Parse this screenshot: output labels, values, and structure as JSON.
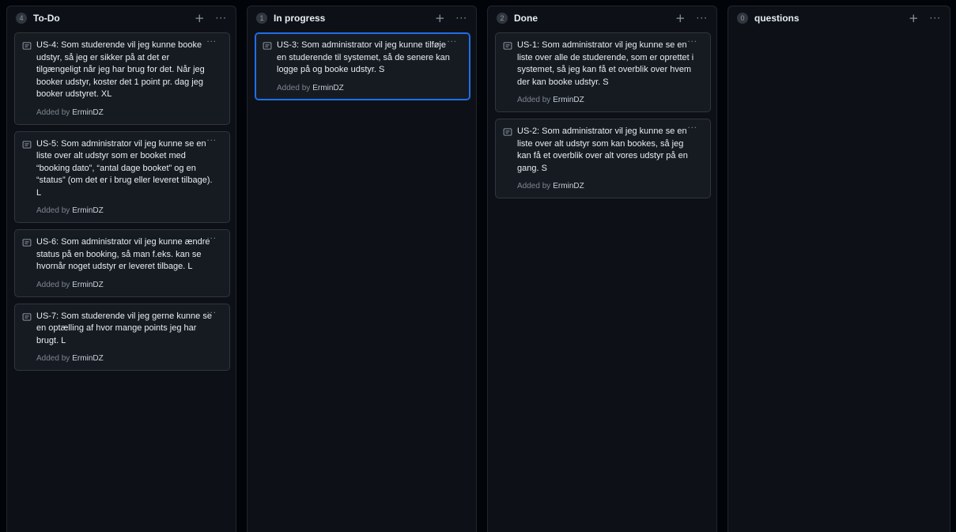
{
  "columns": [
    {
      "count": "4",
      "title": "To-Do",
      "cards": [
        {
          "title": "US-4: Som studerende vil jeg kunne booke udstyr, så jeg er sikker på at det er tilgængeligt når jeg har brug for det. Når jeg booker udstyr, koster det 1 point pr. dag jeg booker udstyret. XL",
          "added_by": "Added by",
          "author": "ErminDZ"
        },
        {
          "title": "US-5: Som administrator vil jeg kunne se en liste over alt udstyr som er booket med “booking dato”, “antal dage booket” og en “status” (om det er i brug eller leveret tilbage). L",
          "added_by": "Added by",
          "author": "ErminDZ"
        },
        {
          "title": "US-6: Som administrator vil jeg kunne ændre status på en booking, så man f.eks. kan se hvornår noget udstyr er leveret tilbage. L",
          "added_by": "Added by",
          "author": "ErminDZ"
        },
        {
          "title": "US-7: Som studerende vil jeg gerne kunne se en optælling af hvor mange points jeg har brugt. L",
          "added_by": "Added by",
          "author": "ErminDZ"
        }
      ]
    },
    {
      "count": "1",
      "title": "In progress",
      "cards": [
        {
          "title": "US-3: Som administrator vil jeg kunne tilføje en studerende til systemet, så de senere kan logge på og booke udstyr. S",
          "added_by": "Added by",
          "author": "ErminDZ",
          "selected": true
        }
      ]
    },
    {
      "count": "2",
      "title": "Done",
      "cards": [
        {
          "title": "US-1: Som administrator vil jeg kunne se en liste over alle de studerende, som er oprettet i systemet, så jeg kan få et overblik over hvem der kan booke udstyr. S",
          "added_by": "Added by",
          "author": "ErminDZ"
        },
        {
          "title": "US-2: Som administrator vil jeg kunne se en liste over alt udstyr som kan bookes, så jeg kan få et overblik over alt vores udstyr på en gang. S",
          "added_by": "Added by",
          "author": "ErminDZ"
        }
      ]
    },
    {
      "count": "0",
      "title": "questions",
      "cards": []
    }
  ],
  "icons": {
    "add": "plus-icon",
    "more": "ellipsis-icon",
    "note": "note-icon"
  },
  "colors": {
    "background": "#010409",
    "column": "#0d1117",
    "card": "#161b22",
    "selected_border": "#1f6feb"
  }
}
